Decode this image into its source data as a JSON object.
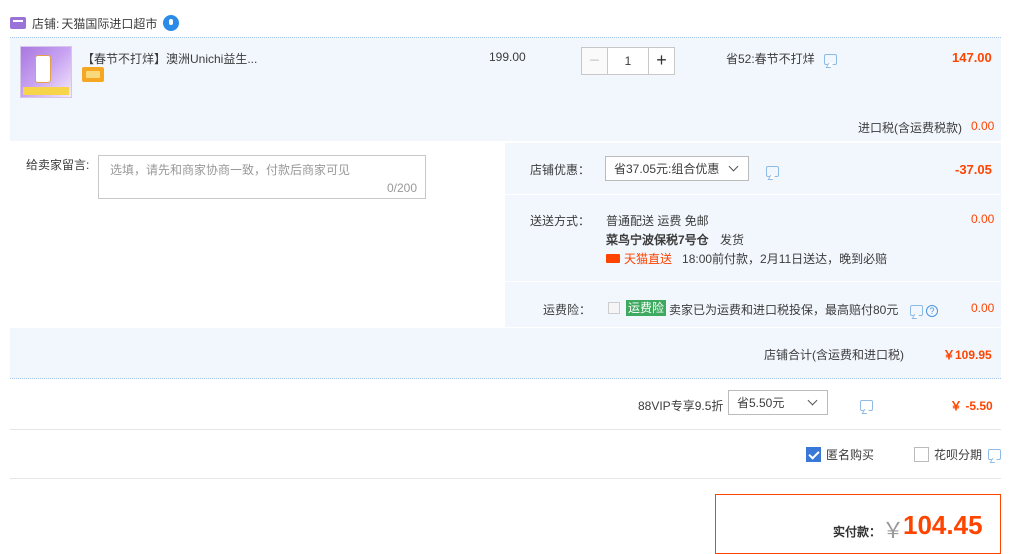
{
  "shop": {
    "label": "店铺:",
    "name": "天猫国际进口超市"
  },
  "item": {
    "title": "【春节不打烊】澳洲Unichi益生...",
    "price": "199.00",
    "quantity": "1",
    "minus": "−",
    "plus": "+",
    "promo": "省52:春节不打烊",
    "subtotal": "147.00",
    "tax_label": "进口税(含运费税款)",
    "tax_value": "0.00"
  },
  "memo": {
    "label": "给卖家留言:",
    "placeholder": "选填，请先和商家协商一致，付款后商家可见",
    "count": "0/200"
  },
  "discount": {
    "label": "店铺优惠：",
    "selected": "省37.05元:组合优惠",
    "value": "-37.05"
  },
  "shipping": {
    "label": "送送方式：",
    "method": "普通配送 运费 免邮",
    "warehouse": "菜鸟宁波保税7号仓",
    "ship_from": "发货",
    "tmall_direct": "天猫直送",
    "eta": "18:00前付款，2月11日送达，晚到必赔",
    "value": "0.00"
  },
  "insurance": {
    "label": "运费险：",
    "tag": "运费险",
    "text": "卖家已为运费和进口税投保，最高赔付80元",
    "value": "0.00"
  },
  "shop_total": {
    "label": "店铺合计(含运费和进口税)",
    "value": "￥109.95"
  },
  "vip": {
    "label": "88VIP专享9.5折",
    "selected": "省5.50元",
    "value": "￥ -5.50"
  },
  "options": {
    "anonymous": "匿名购买",
    "huabei": "花呗分期"
  },
  "payment": {
    "label": "实付款：",
    "yen": "￥",
    "amount": "104.45"
  },
  "colors": {
    "accent": "#ff4400",
    "panel": "#f2f7fd",
    "tag_green": "#3eaa5f",
    "checkbox": "#3a78d8"
  },
  "icons": [
    "shop-icon",
    "wangwang-icon",
    "chat-icon",
    "question-icon",
    "chevron-down-icon",
    "checkbox-icon"
  ]
}
